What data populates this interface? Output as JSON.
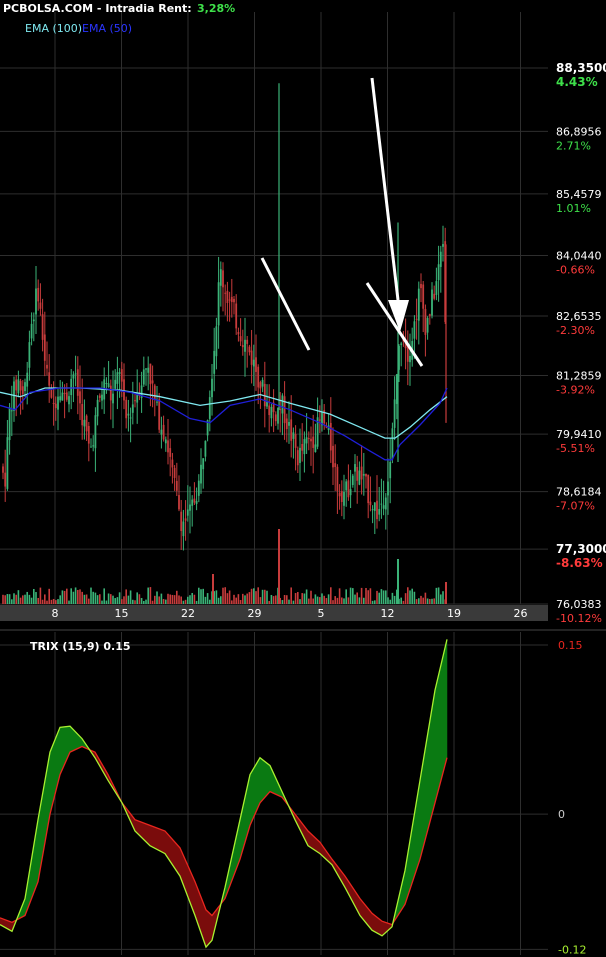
{
  "header": {
    "site": "PCBOLSA.COM",
    "mode": "- Intradia  Rent:",
    "rent": "3,28%"
  },
  "legend": {
    "ema100": "EMA (100)",
    "ema50": "EMA (50)"
  },
  "colors": {
    "up": "#3bb378",
    "down": "#c83c3c",
    "ema100": "#7fe8f0",
    "ema50": "#1f1fd8",
    "trix": "#e8261e",
    "signal": "#a8f030",
    "fill_up": "#0a7a12",
    "fill_down": "#7a0c0c",
    "grid": "#2e2e2e"
  },
  "chart_data": [
    {
      "type": "candlestick",
      "x_ticks": [
        "8",
        "15",
        "22",
        "29",
        "5",
        "12",
        "19",
        "26"
      ],
      "y_levels": [
        {
          "price": "88,3500",
          "pct": "4.43%",
          "dir": "up",
          "bold": true
        },
        {
          "price": "86,8956",
          "pct": "2.71%",
          "dir": "up"
        },
        {
          "price": "85,4579",
          "pct": "1.01%",
          "dir": "up"
        },
        {
          "price": "84,0440",
          "pct": "-0.66%",
          "dir": "down"
        },
        {
          "price": "82,6535",
          "pct": "-2.30%",
          "dir": "down"
        },
        {
          "price": "81,2859",
          "pct": "-3.92%",
          "dir": "down"
        },
        {
          "price": "79,9410",
          "pct": "-5.51%",
          "dir": "down"
        },
        {
          "price": "78,6184",
          "pct": "-7.07%",
          "dir": "down"
        },
        {
          "price": "77,3000",
          "pct": "-8.63%",
          "dir": "down",
          "bold": true
        },
        {
          "price": "76,0383",
          "pct": "-10.12%",
          "dir": "down"
        }
      ],
      "y_range": [
        76.0383,
        88.35
      ],
      "anchor_points": [
        [
          0,
          79.2
        ],
        [
          5,
          78.9
        ],
        [
          10,
          80.6
        ],
        [
          18,
          81.2
        ],
        [
          24,
          80.8
        ],
        [
          30,
          82.3
        ],
        [
          38,
          83.3
        ],
        [
          45,
          81.6
        ],
        [
          52,
          80.5
        ],
        [
          60,
          81.1
        ],
        [
          65,
          80.7
        ],
        [
          73,
          81.4
        ],
        [
          82,
          80.4
        ],
        [
          90,
          79.5
        ],
        [
          98,
          80.6
        ],
        [
          106,
          81.2
        ],
        [
          112,
          80.7
        ],
        [
          120,
          81.5
        ],
        [
          125,
          80.2
        ],
        [
          132,
          80.6
        ],
        [
          140,
          81.1
        ],
        [
          148,
          81.6
        ],
        [
          156,
          80.5
        ],
        [
          166,
          79.9
        ],
        [
          174,
          78.8
        ],
        [
          182,
          77.9
        ],
        [
          190,
          78.1
        ],
        [
          200,
          78.9
        ],
        [
          207,
          80.4
        ],
        [
          214,
          81.9
        ],
        [
          220,
          83.7
        ],
        [
          226,
          83.2
        ],
        [
          234,
          82.7
        ],
        [
          242,
          82.2
        ],
        [
          250,
          81.8
        ],
        [
          258,
          81.3
        ],
        [
          266,
          80.7
        ],
        [
          274,
          80.4
        ],
        [
          282,
          80.6
        ],
        [
          290,
          80.0
        ],
        [
          298,
          79.4
        ],
        [
          306,
          79.7
        ],
        [
          314,
          79.9
        ],
        [
          322,
          80.3
        ],
        [
          330,
          79.8
        ],
        [
          338,
          78.7
        ],
        [
          346,
          78.6
        ],
        [
          354,
          79.1
        ],
        [
          362,
          78.9
        ],
        [
          370,
          78.5
        ],
        [
          378,
          78.1
        ],
        [
          384,
          78.6
        ],
        [
          390,
          79.1
        ],
        [
          396,
          81.2
        ],
        [
          402,
          82.4
        ],
        [
          408,
          81.8
        ],
        [
          414,
          82.4
        ],
        [
          420,
          83.3
        ],
        [
          426,
          82.4
        ],
        [
          432,
          83.0
        ],
        [
          438,
          83.6
        ],
        [
          443,
          84.4
        ],
        [
          447,
          81.0
        ]
      ],
      "ema100": [
        [
          0,
          80.9
        ],
        [
          20,
          80.8
        ],
        [
          45,
          81.0
        ],
        [
          80,
          81.0
        ],
        [
          120,
          80.95
        ],
        [
          160,
          80.8
        ],
        [
          200,
          80.6
        ],
        [
          230,
          80.7
        ],
        [
          260,
          80.85
        ],
        [
          290,
          80.65
        ],
        [
          330,
          80.4
        ],
        [
          360,
          80.1
        ],
        [
          385,
          79.85
        ],
        [
          395,
          79.85
        ],
        [
          410,
          80.1
        ],
        [
          430,
          80.5
        ],
        [
          447,
          80.8
        ]
      ],
      "ema50": [
        [
          0,
          80.6
        ],
        [
          15,
          80.5
        ],
        [
          30,
          80.9
        ],
        [
          60,
          81.0
        ],
        [
          100,
          81.0
        ],
        [
          130,
          80.9
        ],
        [
          160,
          80.7
        ],
        [
          190,
          80.3
        ],
        [
          210,
          80.2
        ],
        [
          230,
          80.6
        ],
        [
          260,
          80.75
        ],
        [
          290,
          80.5
        ],
        [
          320,
          80.2
        ],
        [
          345,
          79.9
        ],
        [
          370,
          79.55
        ],
        [
          385,
          79.35
        ],
        [
          392,
          79.35
        ],
        [
          400,
          79.7
        ],
        [
          420,
          80.15
        ],
        [
          440,
          80.65
        ],
        [
          447,
          81.0
        ]
      ]
    },
    {
      "type": "line",
      "title": "TRIX (15,9) 0.15",
      "y_ticks": [
        {
          "value": 0.15,
          "label": "0.15",
          "color": "#e8261e"
        },
        {
          "value": 0,
          "label": "0",
          "color": "#cccccc"
        },
        {
          "value": -0.12,
          "label": "-0.12",
          "color": "#a8f030"
        }
      ],
      "y_range": [
        -0.125,
        0.158
      ],
      "series": [
        {
          "key": "trix",
          "points": [
            [
              0,
              -0.098
            ],
            [
              12,
              -0.104
            ],
            [
              25,
              -0.075
            ],
            [
              38,
              -0.005
            ],
            [
              50,
              0.055
            ],
            [
              60,
              0.077
            ],
            [
              70,
              0.078
            ],
            [
              82,
              0.067
            ],
            [
              95,
              0.05
            ],
            [
              108,
              0.03
            ],
            [
              122,
              0.01
            ],
            [
              135,
              -0.015
            ],
            [
              150,
              -0.028
            ],
            [
              165,
              -0.035
            ],
            [
              180,
              -0.055
            ],
            [
              195,
              -0.09
            ],
            [
              206,
              -0.118
            ],
            [
              212,
              -0.112
            ],
            [
              225,
              -0.065
            ],
            [
              240,
              -0.005
            ],
            [
              250,
              0.035
            ],
            [
              260,
              0.05
            ],
            [
              270,
              0.043
            ],
            [
              282,
              0.02
            ],
            [
              295,
              -0.005
            ],
            [
              308,
              -0.028
            ],
            [
              320,
              -0.035
            ],
            [
              332,
              -0.045
            ],
            [
              345,
              -0.065
            ],
            [
              360,
              -0.09
            ],
            [
              372,
              -0.103
            ],
            [
              382,
              -0.108
            ],
            [
              392,
              -0.1
            ],
            [
              405,
              -0.05
            ],
            [
              420,
              0.03
            ],
            [
              435,
              0.11
            ],
            [
              447,
              0.155
            ]
          ]
        },
        {
          "key": "signal",
          "points": [
            [
              0,
              -0.092
            ],
            [
              12,
              -0.096
            ],
            [
              25,
              -0.09
            ],
            [
              38,
              -0.06
            ],
            [
              50,
              0.0
            ],
            [
              60,
              0.035
            ],
            [
              70,
              0.055
            ],
            [
              82,
              0.06
            ],
            [
              95,
              0.055
            ],
            [
              108,
              0.035
            ],
            [
              122,
              0.01
            ],
            [
              135,
              -0.005
            ],
            [
              150,
              -0.01
            ],
            [
              165,
              -0.015
            ],
            [
              180,
              -0.03
            ],
            [
              195,
              -0.06
            ],
            [
              206,
              -0.085
            ],
            [
              212,
              -0.09
            ],
            [
              225,
              -0.075
            ],
            [
              240,
              -0.04
            ],
            [
              250,
              -0.01
            ],
            [
              260,
              0.01
            ],
            [
              270,
              0.02
            ],
            [
              282,
              0.015
            ],
            [
              295,
              0.0
            ],
            [
              308,
              -0.015
            ],
            [
              320,
              -0.025
            ],
            [
              332,
              -0.04
            ],
            [
              345,
              -0.055
            ],
            [
              360,
              -0.075
            ],
            [
              372,
              -0.088
            ],
            [
              382,
              -0.095
            ],
            [
              392,
              -0.098
            ],
            [
              405,
              -0.08
            ],
            [
              420,
              -0.04
            ],
            [
              435,
              0.01
            ],
            [
              447,
              0.05
            ]
          ]
        }
      ]
    }
  ]
}
